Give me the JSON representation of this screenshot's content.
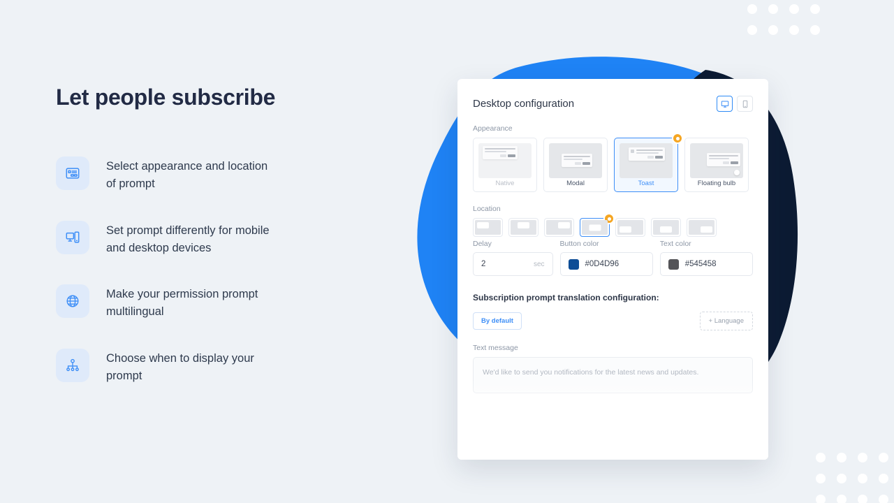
{
  "headline": "Let people subscribe",
  "features": [
    {
      "icon": "prompt-card-icon",
      "text": "Select appearance and location of prompt"
    },
    {
      "icon": "devices-icon",
      "text": "Set prompt differently for mobile and desktop devices"
    },
    {
      "icon": "globe-icon",
      "text": "Make your permission prompt multilingual"
    },
    {
      "icon": "sitemap-icon",
      "text": "Choose when to display your prompt"
    }
  ],
  "card": {
    "title": "Desktop configuration",
    "device_toggle": [
      {
        "name": "desktop",
        "icon": "monitor-icon",
        "selected": true
      },
      {
        "name": "mobile",
        "icon": "phone-icon",
        "selected": false
      }
    ],
    "appearance": {
      "label": "Appearance",
      "options": [
        {
          "name": "Native",
          "selected": false,
          "disabled": true
        },
        {
          "name": "Modal",
          "selected": false,
          "disabled": false
        },
        {
          "name": "Toast",
          "selected": true,
          "disabled": false
        },
        {
          "name": "Floating bulb",
          "selected": false,
          "disabled": false
        }
      ]
    },
    "location": {
      "label": "Location",
      "options": [
        {
          "position": "top-left",
          "selected": false
        },
        {
          "position": "top-center",
          "selected": false
        },
        {
          "position": "top-right",
          "selected": false
        },
        {
          "position": "center",
          "selected": true
        },
        {
          "position": "bottom-left",
          "selected": false
        },
        {
          "position": "bottom-center",
          "selected": false
        },
        {
          "position": "bottom-right",
          "selected": false
        }
      ]
    },
    "fields": {
      "delay": {
        "label": "Delay",
        "value": "2",
        "suffix": "sec"
      },
      "button_color": {
        "label": "Button color",
        "value": "#0D4D96",
        "swatch": "#0D4D96"
      },
      "text_color": {
        "label": "Text color",
        "value": "#545458",
        "swatch": "#545458"
      }
    },
    "translation": {
      "title": "Subscription prompt translation configuration:",
      "by_default_label": "By default",
      "add_language_label": "+ Language",
      "text_message_label": "Text message",
      "text_message_placeholder": "We'd like to send you notifications for the latest news and updates."
    }
  },
  "colors": {
    "background": "#eef2f6",
    "accent_blue": "#1f83f5",
    "navy": "#0c1b33",
    "heading": "#222b45",
    "badge_orange": "#f5a623"
  }
}
